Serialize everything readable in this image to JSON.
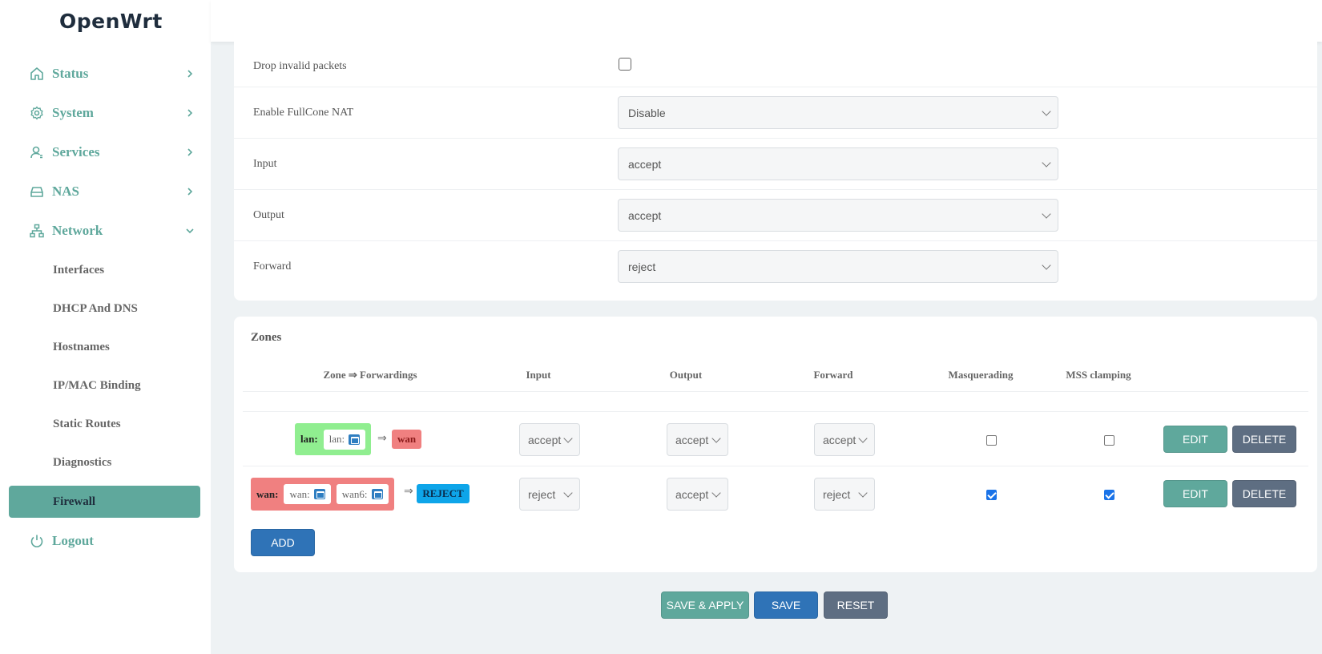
{
  "brand": "OpenWrt",
  "sidebar": {
    "items": [
      {
        "label": "Status",
        "icon": "home-icon"
      },
      {
        "label": "System",
        "icon": "gear-icon"
      },
      {
        "label": "Services",
        "icon": "user-icon"
      },
      {
        "label": "NAS",
        "icon": "drive-icon"
      },
      {
        "label": "Network",
        "icon": "network-icon"
      }
    ],
    "network_sub": [
      "Interfaces",
      "DHCP And DNS",
      "Hostnames",
      "IP/MAC Binding",
      "Static Routes",
      "Diagnostics",
      "Firewall"
    ],
    "logout": "Logout"
  },
  "settings": {
    "drop_invalid": {
      "label": "Drop invalid packets",
      "checked": false
    },
    "fullcone": {
      "label": "Enable FullCone NAT",
      "value": "Disable"
    },
    "input": {
      "label": "Input",
      "value": "accept"
    },
    "output": {
      "label": "Output",
      "value": "accept"
    },
    "forward": {
      "label": "Forward",
      "value": "reject"
    }
  },
  "zones": {
    "title": "Zones",
    "headers": [
      "Zone ⇒ Forwardings",
      "Input",
      "Output",
      "Forward",
      "Masquerading",
      "MSS clamping"
    ],
    "rows": [
      {
        "zone": "lan:",
        "networks": [
          "lan:"
        ],
        "arrow": "⇒",
        "forward_to": "wan",
        "input": "accept",
        "output": "accept",
        "forward": "accept",
        "masquerading": false,
        "mss_clamping": false,
        "edit": "EDIT",
        "delete": "DELETE"
      },
      {
        "zone": "wan:",
        "networks": [
          "wan:",
          "wan6:"
        ],
        "arrow": "⇒",
        "forward_to": "REJECT",
        "input": "reject",
        "output": "accept",
        "forward": "reject",
        "masquerading": true,
        "mss_clamping": true,
        "edit": "EDIT",
        "delete": "DELETE"
      }
    ],
    "add": "ADD"
  },
  "footer": {
    "save_apply": "SAVE & APPLY",
    "save": "SAVE",
    "reset": "RESET"
  },
  "colors": {
    "accent": "#5fa89c",
    "lan_zone": "#90ee90",
    "wan_zone": "#f08080",
    "reject_tag": "#0ea5e9",
    "primary": "#2f73b7",
    "secondary": "#5e6e82"
  }
}
